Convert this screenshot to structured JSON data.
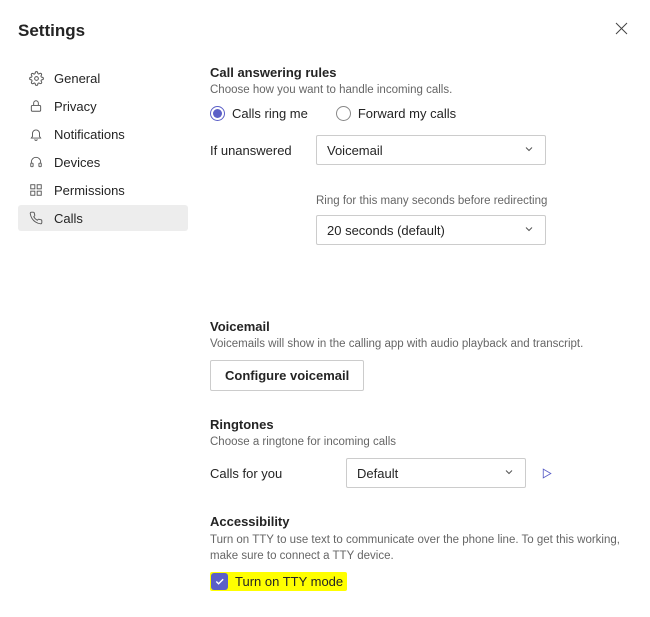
{
  "header": {
    "title": "Settings"
  },
  "sidebar": {
    "items": [
      {
        "label": "General"
      },
      {
        "label": "Privacy"
      },
      {
        "label": "Notifications"
      },
      {
        "label": "Devices"
      },
      {
        "label": "Permissions"
      },
      {
        "label": "Calls"
      }
    ]
  },
  "calls": {
    "answering": {
      "title": "Call answering rules",
      "subtitle": "Choose how you want to handle incoming calls.",
      "radio_ring": "Calls ring me",
      "radio_forward": "Forward my calls",
      "unanswered_label": "If unanswered",
      "unanswered_value": "Voicemail",
      "ring_hint": "Ring for this many seconds before redirecting",
      "ring_value": "20 seconds (default)"
    },
    "voicemail": {
      "title": "Voicemail",
      "subtitle": "Voicemails will show in the calling app with audio playback and transcript.",
      "button": "Configure voicemail"
    },
    "ringtones": {
      "title": "Ringtones",
      "subtitle": "Choose a ringtone for incoming calls",
      "calls_for_you_label": "Calls for you",
      "calls_for_you_value": "Default"
    },
    "accessibility": {
      "title": "Accessibility",
      "subtitle": "Turn on TTY to use text to communicate over the phone line. To get this working, make sure to connect a TTY device.",
      "tty_label": "Turn on TTY mode"
    }
  }
}
